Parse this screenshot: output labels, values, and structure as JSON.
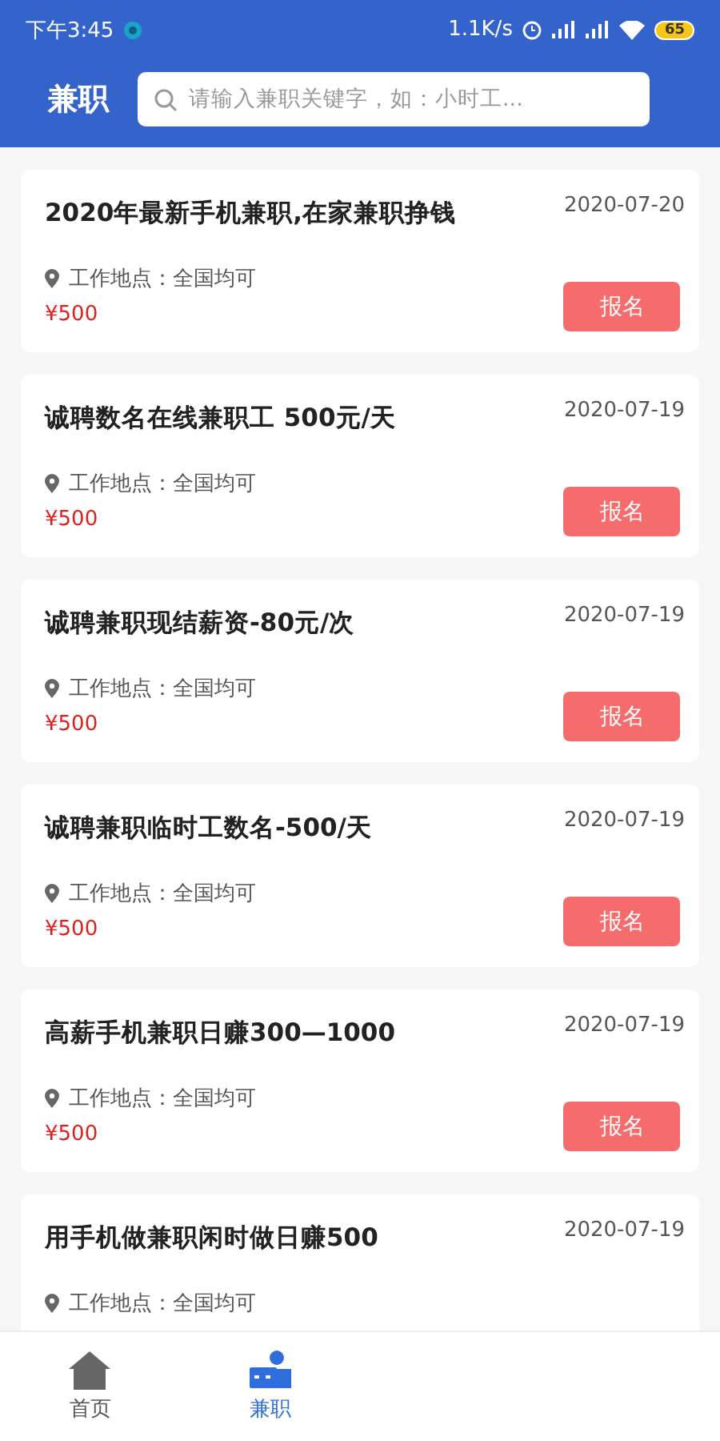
{
  "status_bar": {
    "time": "下午3:45",
    "network_speed": "1.1K/s",
    "battery": "65"
  },
  "header": {
    "title": "兼职",
    "search": {
      "placeholder": "请输入兼职关键字，如：小时工..."
    }
  },
  "jobs": [
    {
      "title": "2020年最新手机兼职,在家兼职挣钱",
      "date": "2020-07-20",
      "location": "工作地点：全国均可",
      "price": "¥500",
      "button": "报名"
    },
    {
      "title": "诚聘数名在线兼职工 500元/天",
      "date": "2020-07-19",
      "location": "工作地点：全国均可",
      "price": "¥500",
      "button": "报名"
    },
    {
      "title": "诚聘兼职现结薪资-80元/次",
      "date": "2020-07-19",
      "location": "工作地点：全国均可",
      "price": "¥500",
      "button": "报名"
    },
    {
      "title": "诚聘兼职临时工数名-500/天",
      "date": "2020-07-19",
      "location": "工作地点：全国均可",
      "price": "¥500",
      "button": "报名"
    },
    {
      "title": "高薪手机兼职日赚300—1000",
      "date": "2020-07-19",
      "location": "工作地点：全国均可",
      "price": "¥500",
      "button": "报名"
    },
    {
      "title": "用手机做兼职闲时做日赚500",
      "date": "2020-07-19",
      "location": "工作地点：全国均可"
    }
  ],
  "tab_bar": [
    {
      "kind": "home",
      "label": "首页",
      "selected": false
    },
    {
      "kind": "job",
      "label": "兼职",
      "selected": true
    }
  ]
}
